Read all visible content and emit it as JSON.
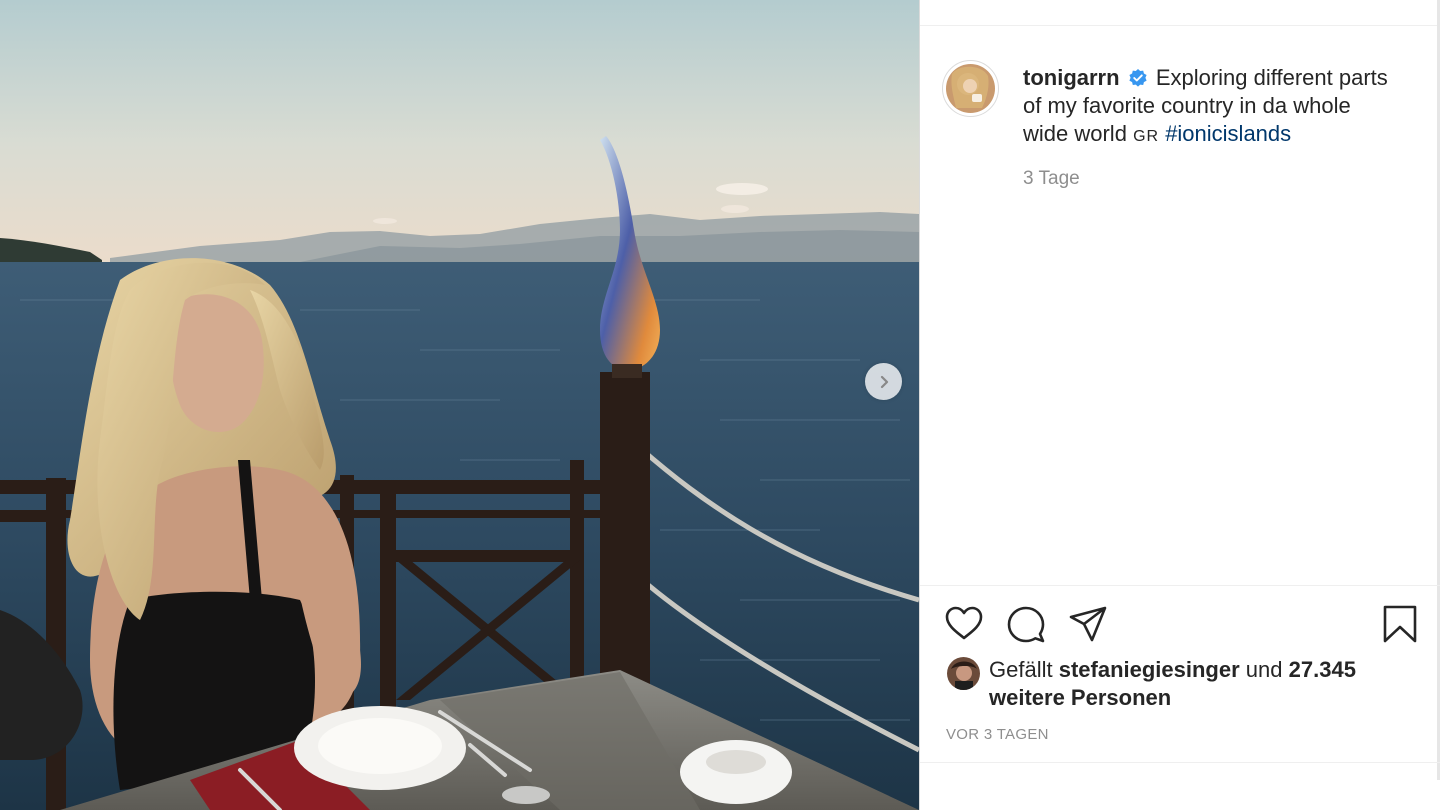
{
  "post": {
    "username": "tonigarrn",
    "caption_text": "Exploring different parts of my favorite country in da whole wide world",
    "flag": "GR",
    "hashtag": "#ionicislands",
    "age_label": "3 Tage"
  },
  "likes": {
    "prefix": "Gefällt",
    "liked_by": "stefaniegiesinger",
    "joiner": "und",
    "others": "27.345 weitere Personen"
  },
  "footer": {
    "age_upper": "VOR 3 TAGEN"
  },
  "icons": {
    "like": "heart-icon",
    "comment": "comment-icon",
    "share": "paper-plane-icon",
    "save": "bookmark-icon",
    "verified": "verified-badge-icon",
    "next": "chevron-right-icon"
  },
  "colors": {
    "verified_blue": "#3897f0",
    "hashtag_blue": "#00376b",
    "muted_gray": "#8e8e8e",
    "text": "#262626"
  }
}
